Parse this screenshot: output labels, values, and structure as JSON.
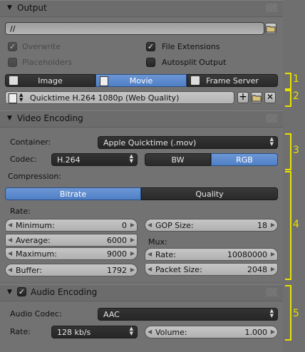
{
  "output": {
    "title": "Output",
    "path_value": "//",
    "overwrite_label": "Overwrite",
    "placeholders_label": "Placeholders",
    "file_extensions_label": "File Extensions",
    "autosplit_label": "Autosplit Output",
    "overwrite_checked": true,
    "placeholders_checked": false,
    "file_extensions_checked": true,
    "autosplit_checked": false,
    "format_tabs": [
      "Image",
      "Movie",
      "Frame Server"
    ],
    "active_format": "Movie",
    "preset_value": "Quicktime H.264 1080p (Web Quality)"
  },
  "video": {
    "title": "Video Encoding",
    "container_label": "Container:",
    "container_value": "Apple Quicktime (.mov)",
    "codec_label": "Codec:",
    "codec_value": "H.264",
    "color_modes": [
      "BW",
      "RGB"
    ],
    "active_color_mode": "RGB",
    "compression_label": "Compression:",
    "compression_tabs": [
      "Bitrate",
      "Quality"
    ],
    "active_compression": "Bitrate",
    "rate_label": "Rate:",
    "minimum_label": "Minimum:",
    "minimum_value": "0",
    "average_label": "Average:",
    "average_value": "6000",
    "maximum_label": "Maximum:",
    "maximum_value": "9000",
    "buffer_label": "Buffer:",
    "buffer_value": "1792",
    "gop_label": "GOP Size:",
    "gop_value": "18",
    "mux_label": "Mux:",
    "mux_rate_label": "Rate:",
    "mux_rate_value": "10080000",
    "packet_label": "Packet Size:",
    "packet_value": "2048"
  },
  "audio": {
    "title": "Audio Encoding",
    "enabled": true,
    "codec_label": "Audio Codec:",
    "codec_value": "AAC",
    "rate_label": "Rate:",
    "rate_value": "128 kb/s",
    "volume_label": "Volume:",
    "volume_value": "1.000"
  },
  "annotations": [
    "1",
    "2",
    "3",
    "4",
    "5"
  ],
  "colors": {
    "accent": "#5b88cc",
    "annotation": "#e8e200"
  },
  "icons": [
    "triangle-down-icon",
    "folder-icon",
    "film-icon",
    "checkmark-icon",
    "plus-icon",
    "close-icon",
    "up-down-arrows-icon"
  ]
}
